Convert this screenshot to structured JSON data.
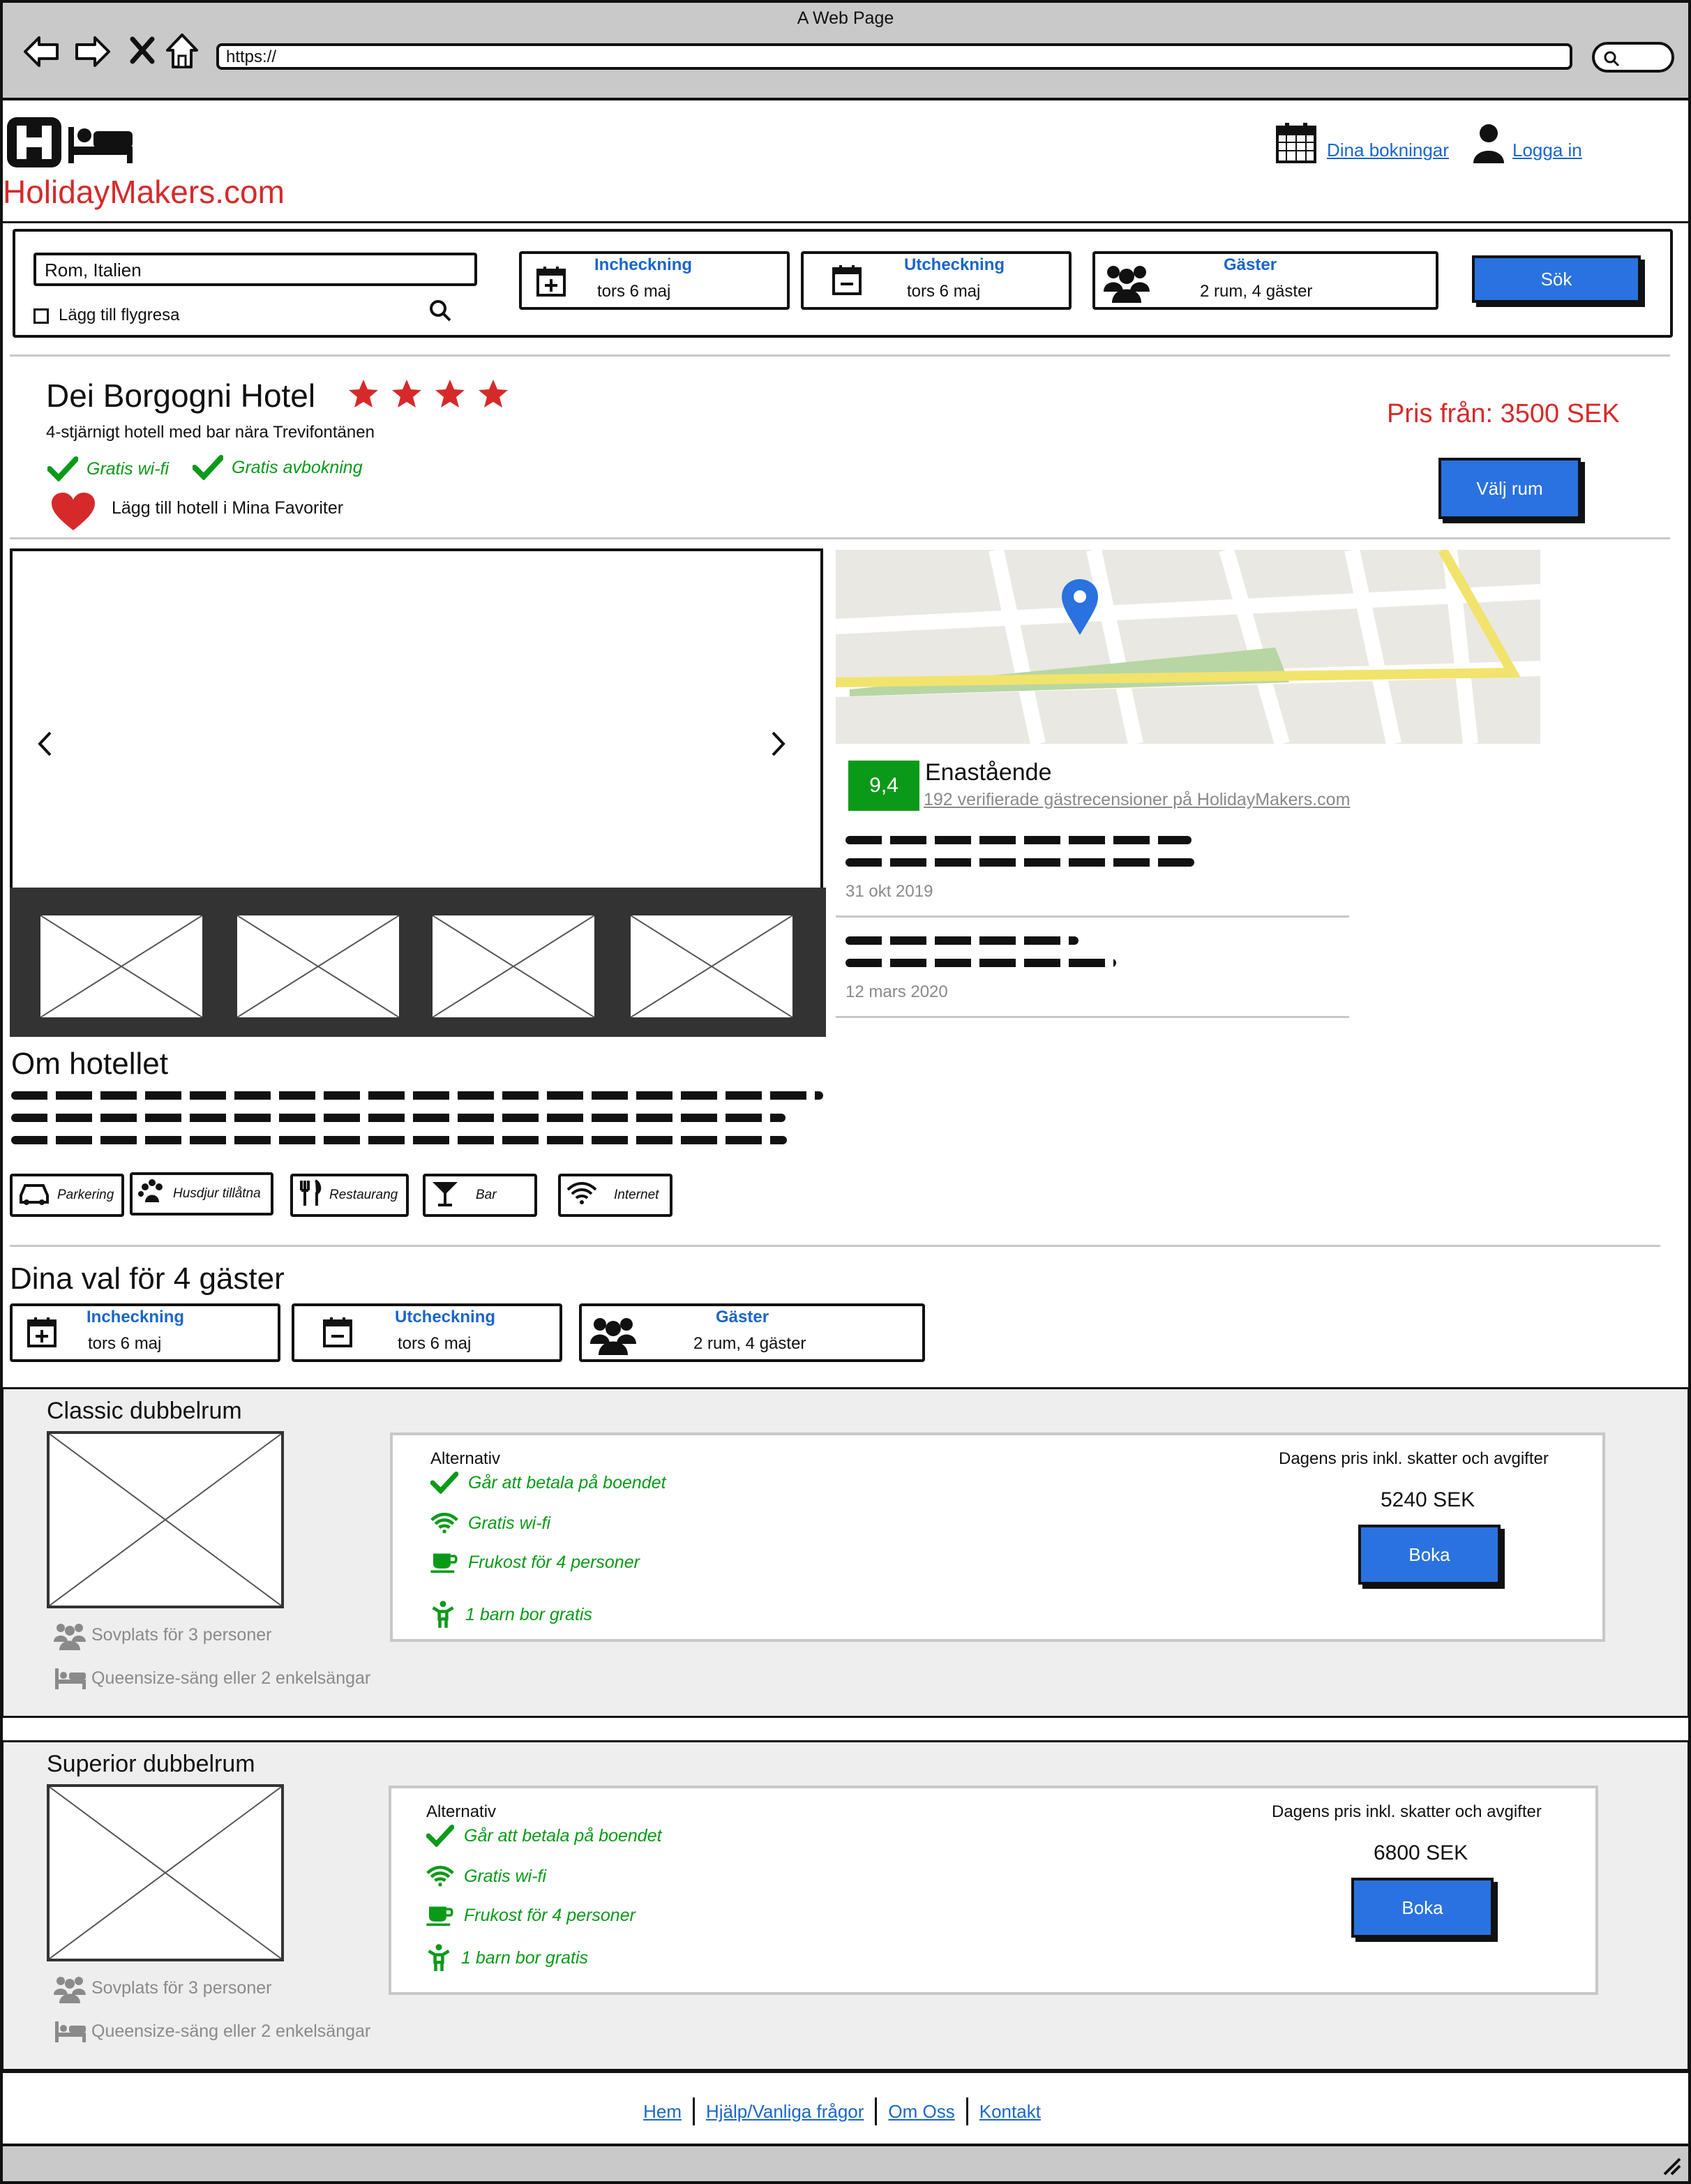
{
  "browser": {
    "window_title": "A Web Page",
    "url": "https://"
  },
  "header": {
    "logo_text": "HolidayMakers.com",
    "bookings_link": "Dina bokningar",
    "login_link": "Logga in"
  },
  "search": {
    "destination_value": "Rom, Italien",
    "flight_checkbox_label": "Lägg till flygresa",
    "checkin_label": "Incheckning",
    "checkin_value": "tors 6 maj",
    "checkout_label": "Utcheckning",
    "checkout_value": "tors 6 maj",
    "guests_label": "Gäster",
    "guests_value": "2 rum, 4 gäster",
    "search_button": "Sök"
  },
  "hotel": {
    "name": "Dei Borgogni Hotel",
    "stars": 4,
    "subtitle": "4-stjärnigt hotell med bar nära Trevifontänen",
    "perk_wifi": "Gratis wi-fi",
    "perk_cancel": "Gratis avbokning",
    "favorite_label": "Lägg till hotell i Mina Favoriter",
    "price_from": "Pris från: 3500 SEK",
    "choose_room_button": "Välj rum",
    "colors": {
      "price": "#d62a2a",
      "stars": "#d62a2a",
      "heart": "#d62a2a",
      "accent": "#2a72e0"
    }
  },
  "reviews": {
    "score": "9,4",
    "rating_word": "Enastående",
    "count_link": "192 verifierade gästrecensioner på HolidayMakers.com",
    "items": [
      {
        "date": "31 okt 2019"
      },
      {
        "date": "12 mars 2020"
      }
    ]
  },
  "about": {
    "title": "Om hotellet",
    "amenities": [
      "Parkering",
      "Husdjur tillåtna",
      "Restaurang",
      "Bar",
      "Internet"
    ]
  },
  "choices": {
    "title": "Dina val för 4 gäster",
    "checkin_label": "Incheckning",
    "checkin_value": "tors 6 maj",
    "checkout_label": "Utcheckning",
    "checkout_value": "tors 6 maj",
    "guests_label": "Gäster",
    "guests_value": "2 rum, 4 gäster"
  },
  "rooms": [
    {
      "name": "Classic dubbelrum",
      "sleeps": "Sovplats för 3 personer",
      "bed": "Queensize-säng eller 2 enkelsängar",
      "alternatives_label": "Alternativ",
      "options": [
        "Går att betala på boendet",
        "Gratis wi-fi",
        "Frukost för 4 personer",
        "1 barn bor gratis"
      ],
      "price_label": "Dagens pris inkl. skatter och avgifter",
      "price": "5240 SEK",
      "book_button": "Boka"
    },
    {
      "name": "Superior dubbelrum",
      "sleeps": "Sovplats för 3 personer",
      "bed": "Queensize-säng eller 2 enkelsängar",
      "alternatives_label": "Alternativ",
      "options": [
        "Går att betala på boendet",
        "Gratis wi-fi",
        "Frukost för 4 personer",
        "1 barn bor gratis"
      ],
      "price_label": "Dagens pris inkl. skatter och avgifter",
      "price": "6800 SEK",
      "book_button": "Boka"
    }
  ],
  "footer": {
    "links": [
      "Hem",
      "Hjälp/Vanliga frågor",
      "Om Oss",
      "Kontakt"
    ]
  }
}
